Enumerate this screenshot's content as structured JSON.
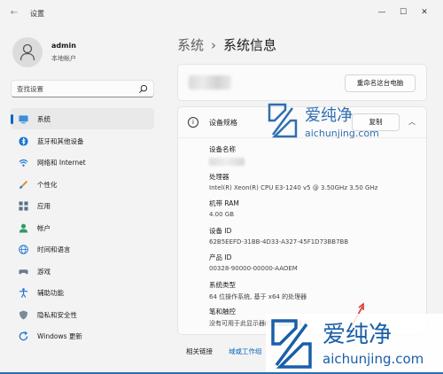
{
  "window": {
    "app_title": "设置",
    "controls": {
      "minimize": "—",
      "maximize": "☐",
      "close": "✕"
    },
    "back": "←"
  },
  "user": {
    "name": "admin",
    "type": "本地帐户"
  },
  "search": {
    "placeholder": "查找设置",
    "value": ""
  },
  "nav": {
    "items": [
      {
        "label": "系统",
        "icon": "monitor-icon",
        "active": true
      },
      {
        "label": "蓝牙和其他设备",
        "icon": "bluetooth-icon",
        "active": false
      },
      {
        "label": "网络和 Internet",
        "icon": "wifi-icon",
        "active": false
      },
      {
        "label": "个性化",
        "icon": "brush-icon",
        "active": false
      },
      {
        "label": "应用",
        "icon": "apps-icon",
        "active": false
      },
      {
        "label": "帐户",
        "icon": "person-icon",
        "active": false
      },
      {
        "label": "时间和语言",
        "icon": "globe-clock-icon",
        "active": false
      },
      {
        "label": "游戏",
        "icon": "gamepad-icon",
        "active": false
      },
      {
        "label": "辅助功能",
        "icon": "accessibility-icon",
        "active": false
      },
      {
        "label": "隐私和安全性",
        "icon": "shield-icon",
        "active": false
      },
      {
        "label": "Windows 更新",
        "icon": "update-icon",
        "active": false
      }
    ]
  },
  "breadcrumb": {
    "parent": "系统",
    "separator": "›",
    "current": "系统信息"
  },
  "device_card": {
    "rename_button": "重命名这台电脑"
  },
  "specs": {
    "title": "设备规格",
    "copy_button": "复制",
    "rows": [
      {
        "label": "设备名称",
        "value": "",
        "hidden": true
      },
      {
        "label": "处理器",
        "value": "Intel(R) Xeon(R) CPU E3-1240 v5 @ 3.50GHz   3.50 GHz"
      },
      {
        "label": "机带 RAM",
        "value": "4.00 GB"
      },
      {
        "label": "设备 ID",
        "value": "62B5EEFD-31BB-4D33-A327-45F1D73BB7BB"
      },
      {
        "label": "产品 ID",
        "value": "00328-90000-00000-AAOEM"
      },
      {
        "label": "系统类型",
        "value": "64 位操作系统, 基于 x64 的处理器"
      },
      {
        "label": "笔和触控",
        "value": "没有可用于此显示器的笔或触控输入"
      }
    ]
  },
  "related": {
    "label": "相关链接",
    "link": "域或工作组"
  },
  "watermark": {
    "brand": "爱纯净",
    "url": "aichunjing.com"
  },
  "colors": {
    "accent": "#0067c0",
    "background": "#f3f3f3",
    "card": "#fbfbfb",
    "watermark_blue": "#1a5fa8"
  }
}
